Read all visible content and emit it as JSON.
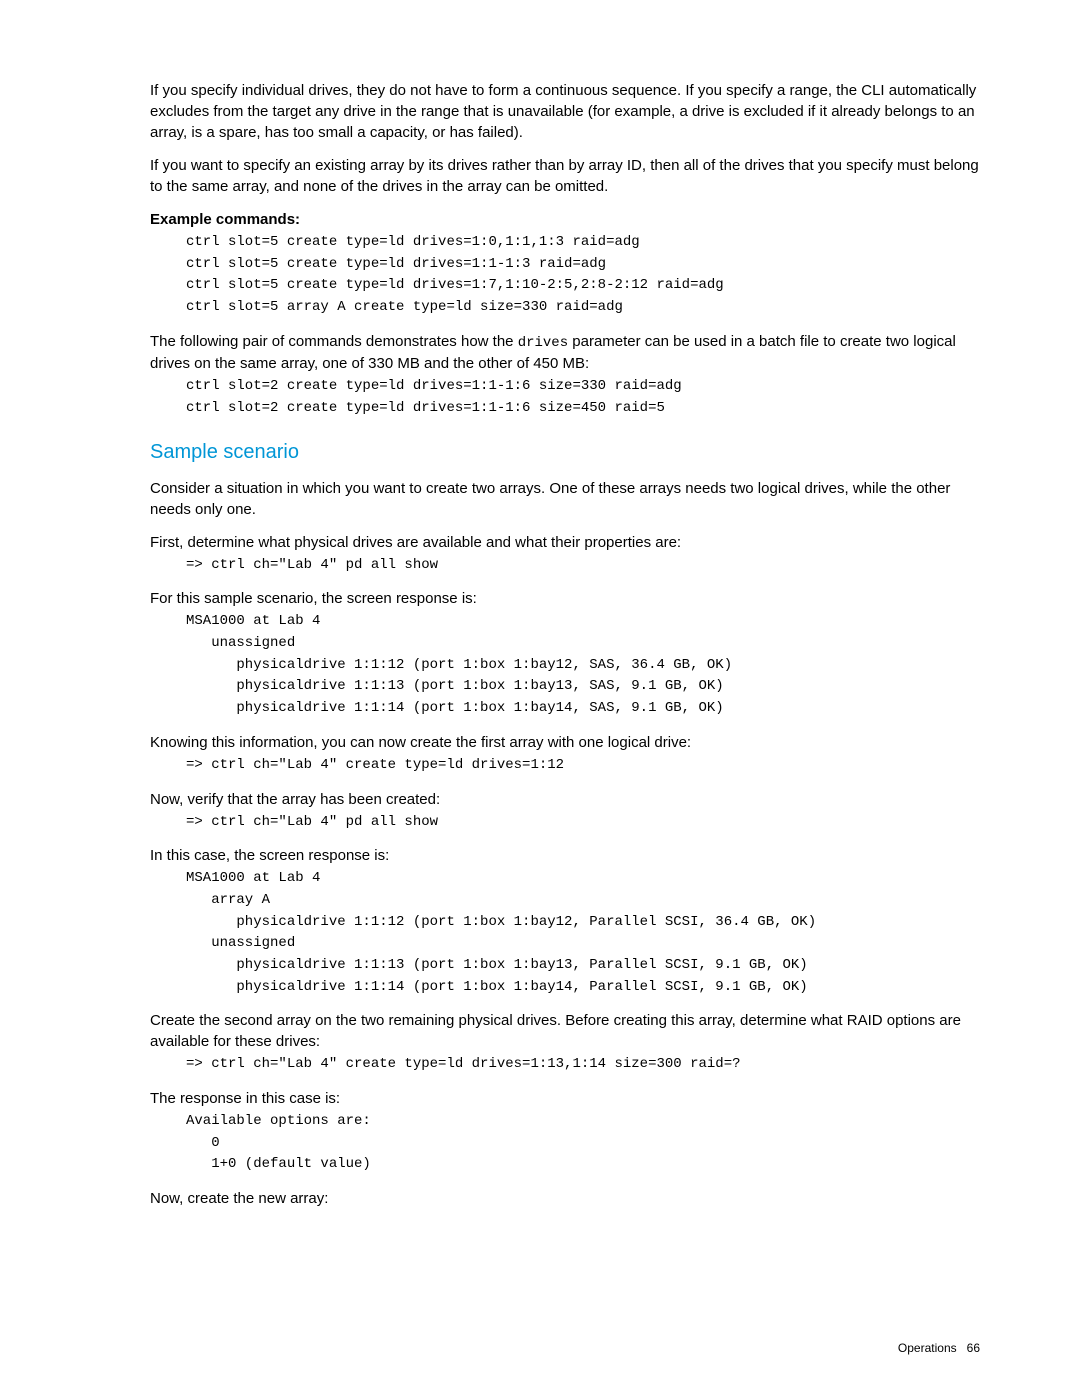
{
  "intro": {
    "p1": "If you specify individual drives, they do not have to form a continuous sequence. If you specify a range, the CLI automatically excludes from the target any drive in the range that is unavailable (for example, a drive is excluded if it already belongs to an array, is a spare, has too small a capacity, or has failed).",
    "p2": "If you want to specify an existing array by its drives rather than by array ID, then all of the drives that you specify must belong to the same array, and none of the drives in the array can be omitted."
  },
  "example": {
    "heading": "Example commands:",
    "code": "ctrl slot=5 create type=ld drives=1:0,1:1,1:3 raid=adg\nctrl slot=5 create type=ld drives=1:1-1:3 raid=adg\nctrl slot=5 create type=ld drives=1:7,1:10-2:5,2:8-2:12 raid=adg\nctrl slot=5 array A create type=ld size=330 raid=adg"
  },
  "pair": {
    "prefix": "The following pair of commands demonstrates how the ",
    "inline": "drives",
    "suffix": " parameter can be used in a batch file to create two logical drives on the same array, one of 330 MB and the other of 450 MB:",
    "code": "ctrl slot=2 create type=ld drives=1:1-1:6 size=330 raid=adg\nctrl slot=2 create type=ld drives=1:1-1:6 size=450 raid=5"
  },
  "sample": {
    "title": "Sample scenario",
    "p1": "Consider a situation in which you want to create two arrays. One of these arrays needs two logical drives, while the other needs only one.",
    "p2": "First, determine what physical drives are available and what their properties are:",
    "code2": "=> ctrl ch=\"Lab 4\" pd all show",
    "p3": "For this sample scenario, the screen response is:",
    "code3": "MSA1000 at Lab 4\n   unassigned\n      physicaldrive 1:1:12 (port 1:box 1:bay12, SAS, 36.4 GB, OK)\n      physicaldrive 1:1:13 (port 1:box 1:bay13, SAS, 9.1 GB, OK)\n      physicaldrive 1:1:14 (port 1:box 1:bay14, SAS, 9.1 GB, OK)",
    "p4": "Knowing this information, you can now create the first array with one logical drive:",
    "code4": "=> ctrl ch=\"Lab 4\" create type=ld drives=1:12",
    "p5": "Now, verify that the array has been created:",
    "code5": "=> ctrl ch=\"Lab 4\" pd all show",
    "p6": "In this case, the screen response is:",
    "code6": "MSA1000 at Lab 4\n   array A\n      physicaldrive 1:1:12 (port 1:box 1:bay12, Parallel SCSI, 36.4 GB, OK)\n   unassigned\n      physicaldrive 1:1:13 (port 1:box 1:bay13, Parallel SCSI, 9.1 GB, OK)\n      physicaldrive 1:1:14 (port 1:box 1:bay14, Parallel SCSI, 9.1 GB, OK)",
    "p7": "Create the second array on the two remaining physical drives. Before creating this array, determine what RAID options are available for these drives:",
    "code7": "=> ctrl ch=\"Lab 4\" create type=ld drives=1:13,1:14 size=300 raid=?",
    "p8": "The response in this case is:",
    "code8": "Available options are:\n   0\n   1+0 (default value)",
    "p9": "Now, create the new array:"
  },
  "footer": {
    "label": "Operations",
    "page": "66"
  }
}
